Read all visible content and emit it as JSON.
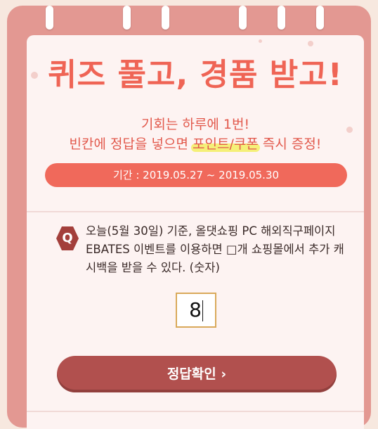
{
  "quiz": {
    "title": "퀴즈 풀고, 경품 받고!",
    "subtitle_line1": "기회는 하루에 1번!",
    "subtitle_line2_before": "빈칸에 정답을 넣으면 ",
    "subtitle_line2_highlight": "포인트/쿠폰",
    "subtitle_line2_after": " 즉시 증정!",
    "period": "기간 : 2019.05.27 ~ 2019.05.30"
  },
  "question": {
    "badge": "Q",
    "text": "오늘(5월 30일) 기준, 올댓쇼핑 PC 해외직구페이지 EBATES 이벤트를 이용하면 □개 쇼핑몰에서 추가 캐시백을 받을 수 있다. (숫자)",
    "answer_value": "8",
    "confirm_label": "정답확인 ›"
  },
  "colors": {
    "frame": "#e39892",
    "accent": "#ef6455",
    "button": "#b1504e",
    "highlight": "#f4f06a"
  }
}
